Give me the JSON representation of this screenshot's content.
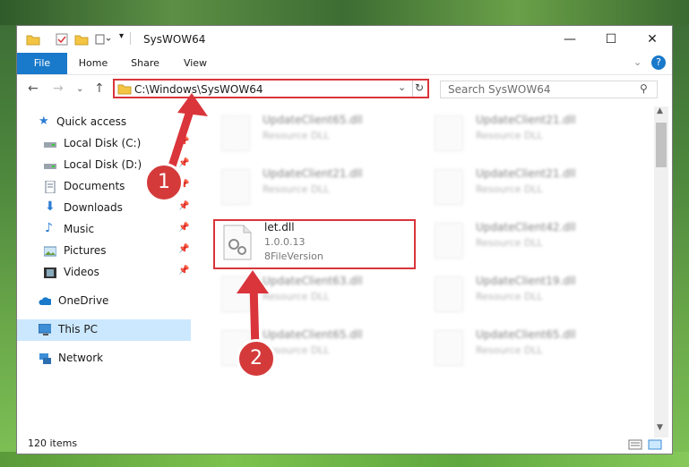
{
  "window": {
    "title": "SysWOW64"
  },
  "ribbon": {
    "tabs": [
      "File",
      "Home",
      "Share",
      "View"
    ]
  },
  "address": {
    "path": "C:\\Windows\\SysWOW64",
    "search_placeholder": "Search SysWOW64"
  },
  "sidebar": {
    "items": [
      {
        "label": "Quick access",
        "icon": "star-icon"
      },
      {
        "label": "Local Disk (C:)",
        "icon": "drive-icon"
      },
      {
        "label": "Local Disk (D:)",
        "icon": "drive-icon"
      },
      {
        "label": "Documents",
        "icon": "documents-icon"
      },
      {
        "label": "Downloads",
        "icon": "download-icon"
      },
      {
        "label": "Music",
        "icon": "music-icon"
      },
      {
        "label": "Pictures",
        "icon": "pictures-icon"
      },
      {
        "label": "Videos",
        "icon": "videos-icon"
      },
      {
        "label": "OneDrive",
        "icon": "cloud-icon"
      },
      {
        "label": "This PC",
        "icon": "computer-icon"
      },
      {
        "label": "Network",
        "icon": "network-icon"
      }
    ]
  },
  "files": {
    "left": [
      {
        "name": "UpdateClient65.dll",
        "sub": "Resource DLL"
      },
      {
        "name": "UpdateClient21.dll",
        "sub": "Resource DLL"
      },
      {
        "name": "let.dll",
        "version": "1.0.0.13",
        "sub": "8FileVersion"
      },
      {
        "name": "UpdateClient63.dll",
        "sub": "Resource DLL"
      },
      {
        "name": "UpdateClient65.dll",
        "sub": "Resource DLL"
      }
    ],
    "right": [
      {
        "name": "UpdateClient21.dll",
        "sub": "Resource DLL"
      },
      {
        "name": "UpdateClient21.dll",
        "sub": "Resource DLL"
      },
      {
        "name": "UpdateClient42.dll",
        "sub": "Resource DLL"
      },
      {
        "name": "UpdateClient19.dll",
        "sub": "Resource DLL"
      },
      {
        "name": "UpdateClient65.dll",
        "sub": "Resource DLL"
      }
    ]
  },
  "status": {
    "items": "120 items"
  },
  "annotations": {
    "step1": "1",
    "step2": "2"
  },
  "colors": {
    "accent": "#1979ca",
    "highlight": "#d9353b",
    "selection": "#cce8ff"
  }
}
